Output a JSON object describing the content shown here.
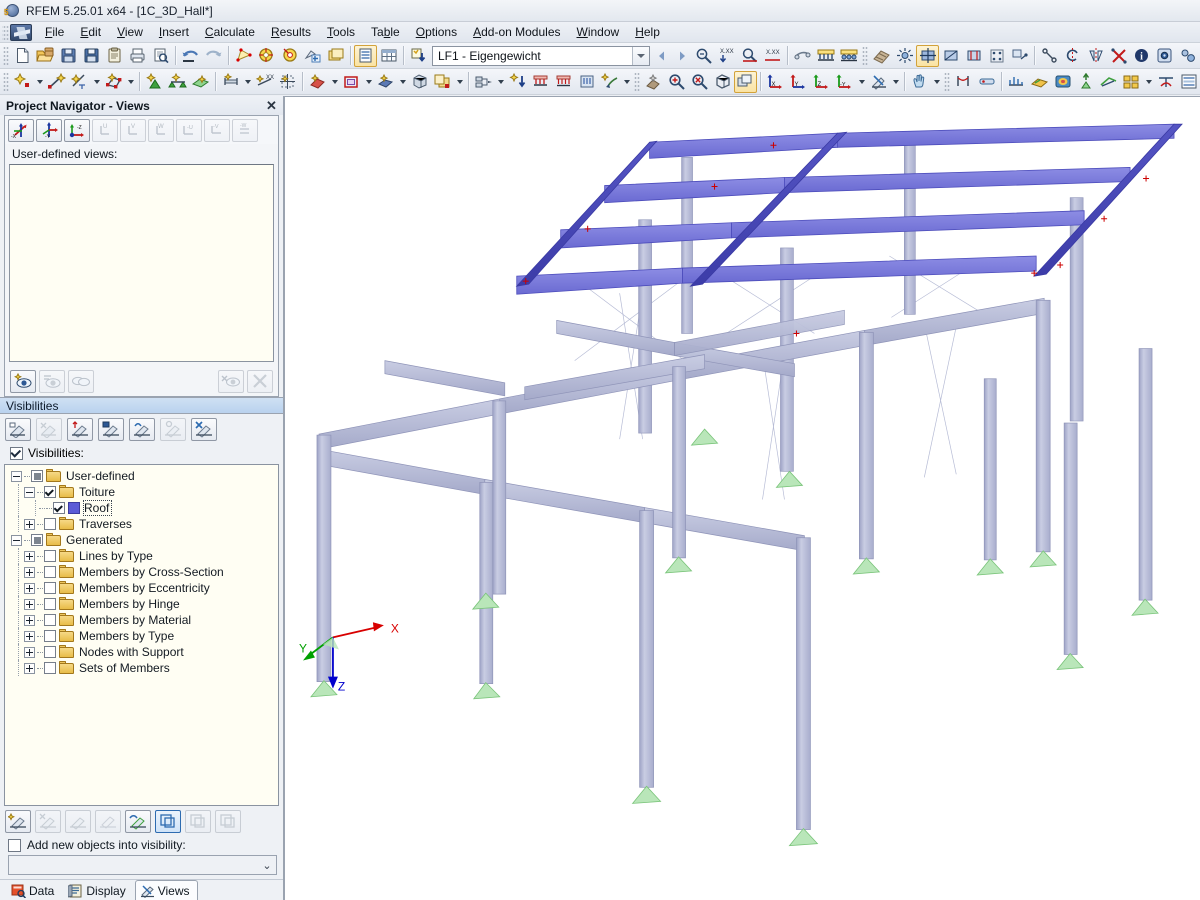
{
  "window": {
    "title": "RFEM 5.25.01 x64 - [1C_3D_Hall*]",
    "logo_icon": "rfem-logo-icon"
  },
  "menu": {
    "app_icon": "rfem-app-icon",
    "items": [
      {
        "label": "File",
        "mnemonic": "F"
      },
      {
        "label": "Edit",
        "mnemonic": "E"
      },
      {
        "label": "View",
        "mnemonic": "V"
      },
      {
        "label": "Insert",
        "mnemonic": "I"
      },
      {
        "label": "Calculate",
        "mnemonic": "C"
      },
      {
        "label": "Results",
        "mnemonic": "R"
      },
      {
        "label": "Tools",
        "mnemonic": "T"
      },
      {
        "label": "Table",
        "mnemonic": "b"
      },
      {
        "label": "Options",
        "mnemonic": "O"
      },
      {
        "label": "Add-on Modules",
        "mnemonic": "A"
      },
      {
        "label": "Window",
        "mnemonic": "W"
      },
      {
        "label": "Help",
        "mnemonic": "H"
      }
    ]
  },
  "toolbar": {
    "load_case": {
      "value": "LF1 - Eigengewicht",
      "icon": "load-case-icon"
    }
  },
  "navigator": {
    "title": "Project Navigator - Views",
    "close_label": "✕",
    "views_label": "User-defined views:",
    "view_buttons": [
      {
        "name": "view-minus-x",
        "label": "-X",
        "enabled": true
      },
      {
        "name": "view-minus-y",
        "label": "-Y",
        "enabled": true
      },
      {
        "name": "view-minus-z",
        "label": "-Z",
        "enabled": true
      },
      {
        "name": "view-u",
        "label": "U",
        "enabled": false
      },
      {
        "name": "view-v",
        "label": "V",
        "enabled": false
      },
      {
        "name": "view-w",
        "label": "W",
        "enabled": false
      },
      {
        "name": "view-minus-u",
        "label": "-U",
        "enabled": false
      },
      {
        "name": "view-minus-v",
        "label": "-V",
        "enabled": false
      },
      {
        "name": "view-minus-w",
        "label": "-W",
        "enabled": false
      }
    ],
    "user_views": [],
    "visibilities": {
      "header": "Visibilities",
      "checkbox_label": "Visibilities:",
      "checkbox_checked": true,
      "tree": [
        {
          "label": "User-defined",
          "level": 0,
          "expander": "minus",
          "check": "part",
          "icon": "folder-icon",
          "selected": false
        },
        {
          "label": "Toiture",
          "level": 1,
          "expander": "minus",
          "check": "checked",
          "icon": "folder-icon",
          "selected": false
        },
        {
          "label": "Roof",
          "level": 2,
          "expander": "none",
          "check": "checked",
          "icon": "color-swatch",
          "selected": true,
          "color": "#5b5bd6"
        },
        {
          "label": "Traverses",
          "level": 1,
          "expander": "plus",
          "check": "empty",
          "icon": "folder-icon",
          "selected": false
        },
        {
          "label": "Generated",
          "level": 0,
          "expander": "minus",
          "check": "part",
          "icon": "folder-icon",
          "selected": false
        },
        {
          "label": "Lines by Type",
          "level": 1,
          "expander": "plus",
          "check": "empty",
          "icon": "folder-icon",
          "selected": false
        },
        {
          "label": "Members by Cross-Section",
          "level": 1,
          "expander": "plus",
          "check": "empty",
          "icon": "folder-icon",
          "selected": false
        },
        {
          "label": "Members by Eccentricity",
          "level": 1,
          "expander": "plus",
          "check": "empty",
          "icon": "folder-icon",
          "selected": false
        },
        {
          "label": "Members by Hinge",
          "level": 1,
          "expander": "plus",
          "check": "empty",
          "icon": "folder-icon",
          "selected": false
        },
        {
          "label": "Members by Material",
          "level": 1,
          "expander": "plus",
          "check": "empty",
          "icon": "folder-icon",
          "selected": false
        },
        {
          "label": "Members by Type",
          "level": 1,
          "expander": "plus",
          "check": "empty",
          "icon": "folder-icon",
          "selected": false
        },
        {
          "label": "Nodes with Support",
          "level": 1,
          "expander": "plus",
          "check": "empty",
          "icon": "folder-icon",
          "selected": false
        },
        {
          "label": "Sets of Members",
          "level": 1,
          "expander": "plus",
          "check": "empty",
          "icon": "folder-icon",
          "selected": false
        }
      ]
    },
    "add_new": {
      "label": "Add new objects into visibility:",
      "checked": false,
      "combo_value": "",
      "chevron": "⌄"
    },
    "tabs": [
      {
        "label": "Data",
        "icon": "data-icon",
        "active": false
      },
      {
        "label": "Display",
        "icon": "display-icon",
        "active": false
      },
      {
        "label": "Views",
        "icon": "views-icon",
        "active": true
      }
    ]
  },
  "viewport": {
    "axes": [
      {
        "label": "X",
        "color": "#d80000"
      },
      {
        "label": "Y",
        "color": "#00a000"
      },
      {
        "label": "Z",
        "color": "#0000cc"
      }
    ],
    "colors": {
      "member": "#b8bcd8",
      "member_edge": "#8f94b8",
      "roof_selected": "#7474dd",
      "roof_selected_dark": "#4a4ab8",
      "support": "#a8e0a8",
      "node": "#cc0000",
      "background": "#ffffff"
    }
  }
}
